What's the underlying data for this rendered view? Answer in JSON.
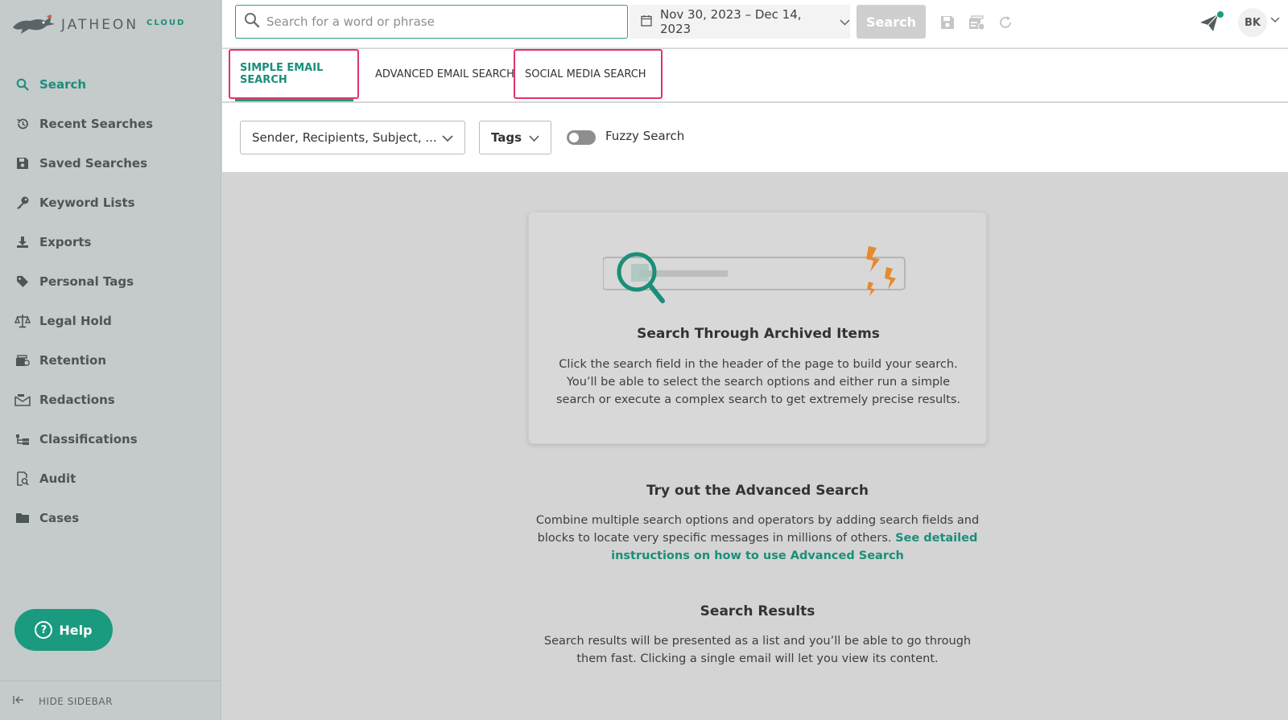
{
  "brand": {
    "name": "JATHEON",
    "suffix": "CLOUD",
    "accent_color": "#1a9a7f",
    "highlight_color": "#e0336b"
  },
  "sidebar": {
    "items": [
      {
        "label": "Search",
        "icon": "search-icon",
        "active": true
      },
      {
        "label": "Recent Searches",
        "icon": "history-icon"
      },
      {
        "label": "Saved Searches",
        "icon": "save-icon"
      },
      {
        "label": "Keyword Lists",
        "icon": "key-icon"
      },
      {
        "label": "Exports",
        "icon": "download-icon"
      },
      {
        "label": "Personal Tags",
        "icon": "tag-icon"
      },
      {
        "label": "Legal Hold",
        "icon": "scales-icon"
      },
      {
        "label": "Retention",
        "icon": "retention-icon"
      },
      {
        "label": "Redactions",
        "icon": "redaction-icon"
      },
      {
        "label": "Classifications",
        "icon": "hierarchy-icon"
      },
      {
        "label": "Audit",
        "icon": "audit-icon"
      },
      {
        "label": "Cases",
        "icon": "folder-icon"
      }
    ],
    "help_label": "Help",
    "hide_label": "HIDE SIDEBAR"
  },
  "topbar": {
    "search_placeholder": "Search for a word or phrase",
    "date_range": "Nov 30, 2023 – Dec 14, 2023",
    "search_button": "Search",
    "avatar_initials": "BK"
  },
  "tabs": {
    "simple": "SIMPLE EMAIL SEARCH",
    "advanced": "ADVANCED EMAIL SEARCH",
    "social": "SOCIAL MEDIA SEARCH"
  },
  "filters": {
    "fields_value": "Sender, Recipients, Subject, ...",
    "tags_label": "Tags",
    "fuzzy_label": "Fuzzy Search",
    "fuzzy_enabled": false
  },
  "card": {
    "title": "Search Through Archived Items",
    "body": "Click the search field in the header of the page to build your search. You’ll be able to select the search options and either run a simple search or execute a complex search to get extremely precise results."
  },
  "advanced_section": {
    "title": "Try out the Advanced Search",
    "body": "Combine multiple search options and operators by adding search fields and blocks to locate very specific messages in millions of others.",
    "link": "See detailed instructions on how to use Advanced Search"
  },
  "results_section": {
    "title": "Search Results",
    "body": "Search results will be presented as a list and you’ll be able to go through them fast. Clicking a single email will let you view its content."
  }
}
